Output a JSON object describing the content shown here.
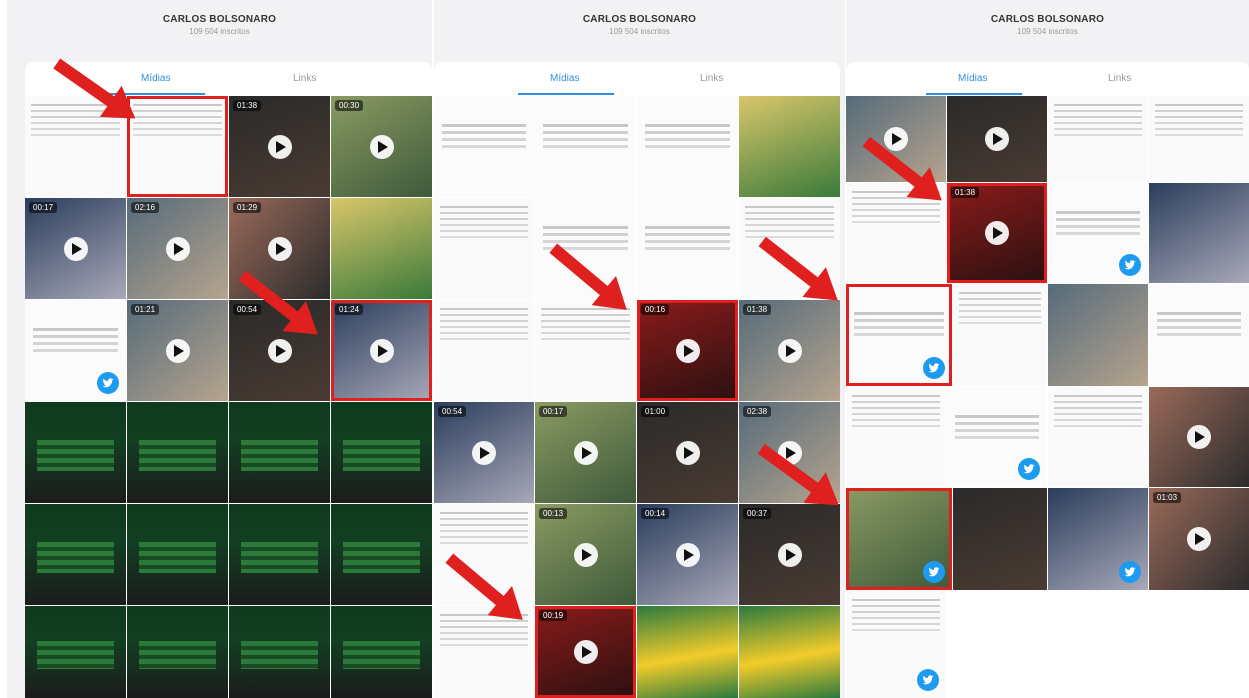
{
  "panels": [
    {
      "title": "CARLOS BOLSONARO",
      "subscribers": "109 504 inscritos",
      "tabs": [
        "Mídias",
        "Links"
      ]
    },
    {
      "title": "CARLOS BOLSONARO",
      "subscribers": "109 504 inscritos",
      "tabs": [
        "Mídias",
        "Links"
      ]
    },
    {
      "title": "CARLOS BOLSONARO",
      "subscribers": "109 504 inscritos",
      "tabs": [
        "Mídias",
        "Links"
      ]
    }
  ],
  "durations": [
    "01:38",
    "00:30",
    "00:17",
    "02:16",
    "01:29",
    "01:21",
    "00:54",
    "01:24",
    "00:16",
    "01:38",
    "00:54",
    "00:17",
    "01:00",
    "02:38",
    "00:13",
    "00:14",
    "00:37",
    "00:19",
    "01:38",
    "01:03"
  ],
  "colors": {
    "accent": "#2f8fe0",
    "highlight": "#e0201f",
    "twitter": "#1d9bf0"
  },
  "icons": {
    "play": "play-icon",
    "twitter": "twitter-bird-icon",
    "arrow": "red-arrow-icon"
  }
}
